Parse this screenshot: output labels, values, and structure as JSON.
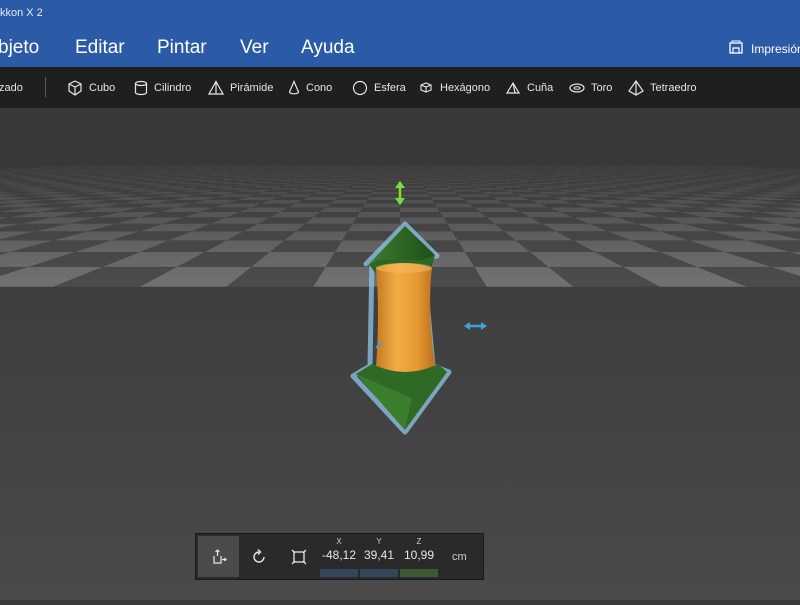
{
  "window": {
    "title_partial": "kkon X 2"
  },
  "menu": {
    "items": [
      "bjeto",
      "Editar",
      "Pintar",
      "Ver",
      "Ayuda"
    ],
    "print_label": "Impresión"
  },
  "toolbar": {
    "first_partial": "zado",
    "items": [
      {
        "label": "Cubo",
        "icon": "cube-icon"
      },
      {
        "label": "Cilindro",
        "icon": "cylinder-icon"
      },
      {
        "label": "Pirámide",
        "icon": "pyramid-icon"
      },
      {
        "label": "Cono",
        "icon": "cone-icon"
      },
      {
        "label": "Esfera",
        "icon": "sphere-icon"
      },
      {
        "label": "Hexágono",
        "icon": "hexagon-icon"
      },
      {
        "label": "Cuña",
        "icon": "wedge-icon"
      },
      {
        "label": "Toro",
        "icon": "torus-icon"
      },
      {
        "label": "Tetraedro",
        "icon": "tetrahedron-icon"
      }
    ]
  },
  "transform": {
    "tools": [
      "move-icon",
      "rotate-icon",
      "scale-icon"
    ],
    "x_label": "X",
    "x_value": "-48,12",
    "y_label": "Y",
    "y_value": "39,41",
    "z_label": "Z",
    "z_value": "10,99",
    "unit": "cm"
  },
  "colors": {
    "title_bar": "#2b5aa6",
    "toolbar": "#1f1f1f",
    "object_body": "#e8a23a",
    "object_caps": "#2f6b27",
    "selection": "#8fc6e8",
    "gizmo_y": "#7adf3a",
    "gizmo_x": "#3fa0e0"
  }
}
